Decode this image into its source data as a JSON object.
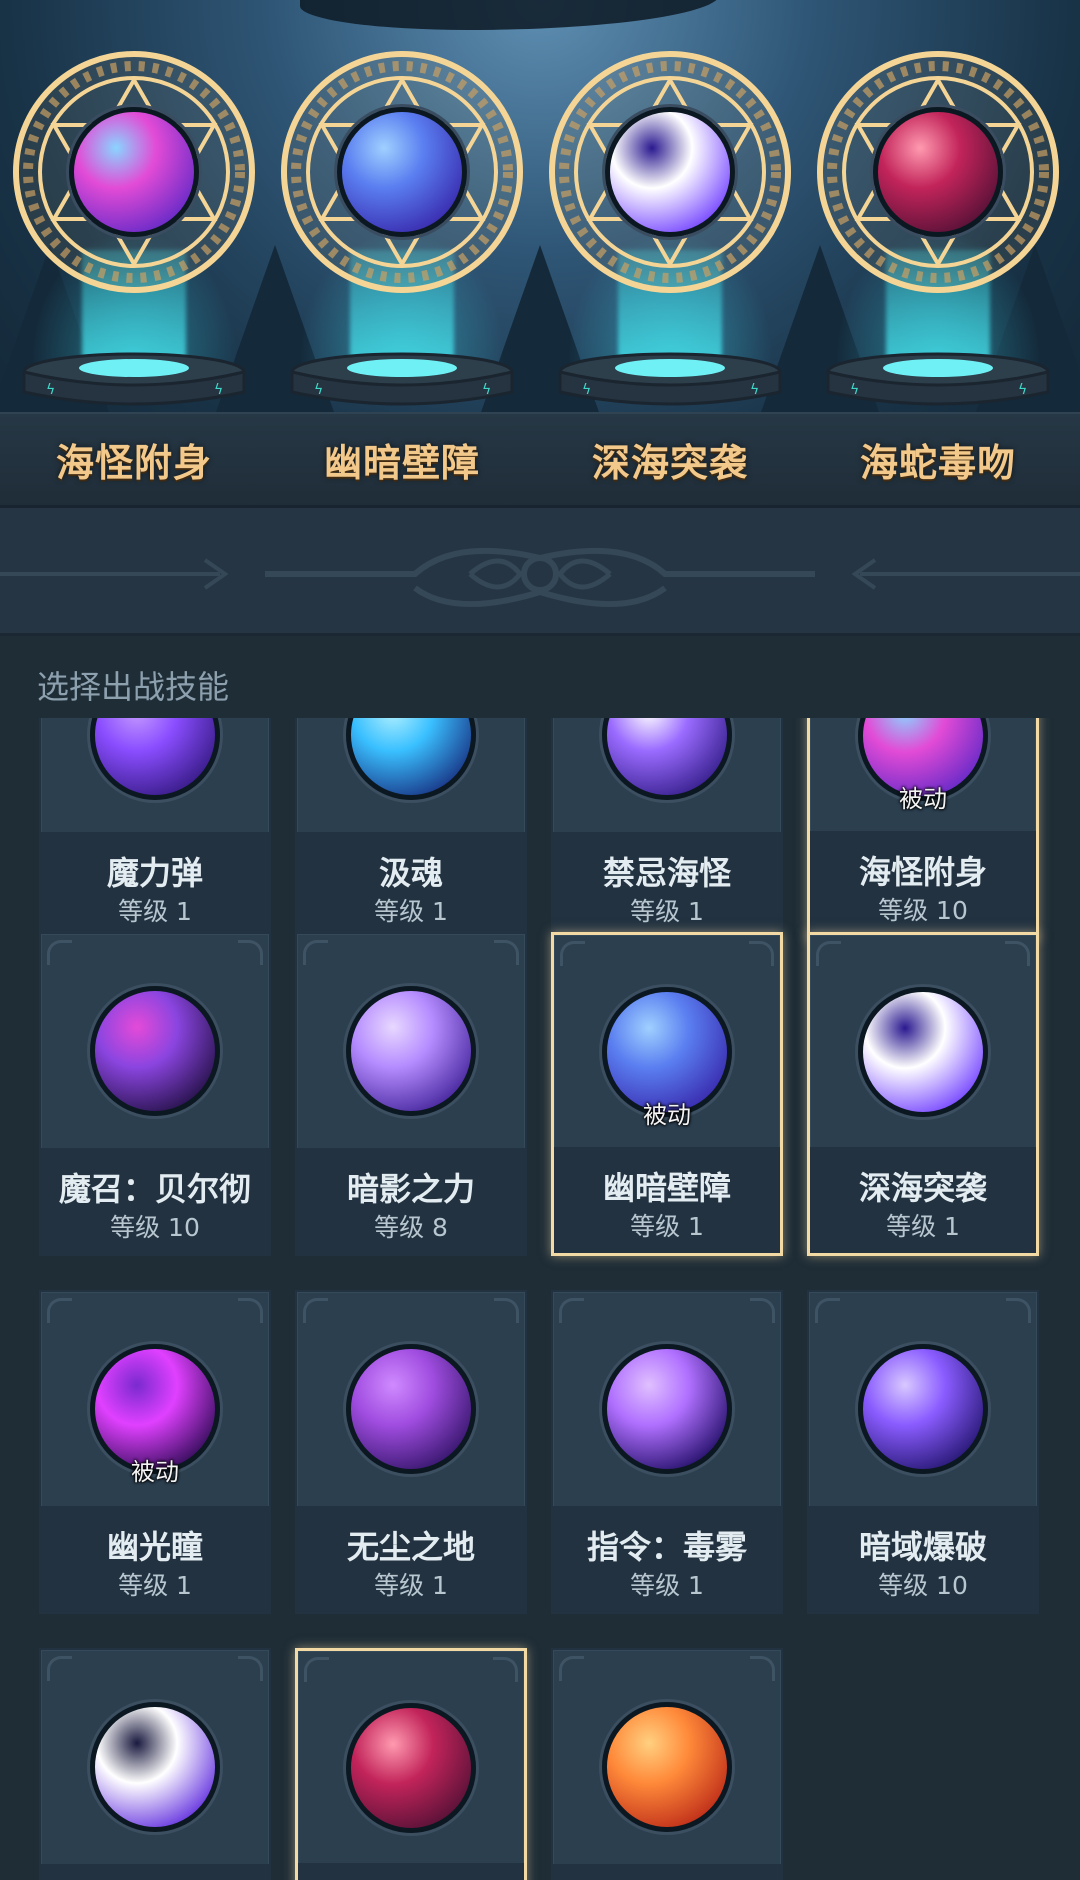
{
  "equipped": [
    {
      "name": "海怪附身",
      "icon": "kraken-possession-icon",
      "colors": [
        "#e24bd6",
        "#6a2bc8",
        "#8ad4ff"
      ]
    },
    {
      "name": "幽暗壁障",
      "icon": "dark-barrier-icon",
      "colors": [
        "#5a7ef0",
        "#3a2db0",
        "#9fd0ff"
      ]
    },
    {
      "name": "深海突袭",
      "icon": "deep-sea-strike-icon",
      "colors": [
        "#ffffff",
        "#7a4cff",
        "#2a1a90"
      ]
    },
    {
      "name": "海蛇毒吻",
      "icon": "sea-serpent-bite-icon",
      "colors": [
        "#c2245a",
        "#5a1238",
        "#ff9ab0"
      ]
    }
  ],
  "select_title": "选择出战技能",
  "skills": [
    {
      "name": "魔力弹",
      "level": "等级 1",
      "icon": "magic-bolt-icon",
      "colors": [
        "#8a4dff",
        "#3a1d8a",
        "#c49aff"
      ]
    },
    {
      "name": "汲魂",
      "level": "等级 1",
      "icon": "soul-drain-icon",
      "colors": [
        "#3ac0ff",
        "#1a3a8a",
        "#b0f0ff"
      ]
    },
    {
      "name": "禁忌海怪",
      "level": "等级 1",
      "icon": "forbidden-kraken-icon",
      "colors": [
        "#9a6bff",
        "#3a2290",
        "#ffffff"
      ]
    },
    {
      "name": "海怪附身",
      "level": "等级 10",
      "badge": "被动",
      "selected": true,
      "icon": "kraken-possession-icon",
      "colors": [
        "#e24bd6",
        "#6a2bc8",
        "#8ad4ff"
      ]
    },
    {
      "name": "魔召：贝尔彻",
      "level": "等级 10",
      "icon": "summon-belch-icon",
      "colors": [
        "#8b45e0",
        "#2a1450",
        "#e44ad8"
      ]
    },
    {
      "name": "暗影之力",
      "level": "等级 8",
      "icon": "shadow-power-icon",
      "colors": [
        "#b58cff",
        "#4a2aa0",
        "#e8d8ff"
      ]
    },
    {
      "name": "幽暗壁障",
      "level": "等级 1",
      "badge": "被动",
      "selected": true,
      "icon": "dark-barrier-icon",
      "colors": [
        "#5a7ef0",
        "#3a2db0",
        "#9fd0ff"
      ]
    },
    {
      "name": "深海突袭",
      "level": "等级 1",
      "selected": true,
      "icon": "deep-sea-strike-icon",
      "colors": [
        "#ffffff",
        "#7a4cff",
        "#2a1a90"
      ]
    },
    {
      "name": "幽光瞳",
      "level": "等级 1",
      "badge": "被动",
      "icon": "dark-eye-icon",
      "colors": [
        "#e040ff",
        "#3a0f60",
        "#7a2ad0"
      ]
    },
    {
      "name": "无尘之地",
      "level": "等级 1",
      "icon": "dustless-land-icon",
      "colors": [
        "#a04de0",
        "#3a1870",
        "#d08aff"
      ]
    },
    {
      "name": "指令：毒雾",
      "level": "等级 1",
      "icon": "poison-fog-icon",
      "colors": [
        "#b070ff",
        "#2a1470",
        "#e0c0ff"
      ]
    },
    {
      "name": "暗域爆破",
      "level": "等级 10",
      "icon": "dark-cube-icon",
      "colors": [
        "#8a5cff",
        "#2a1a78",
        "#d8c8ff"
      ]
    },
    {
      "name": "",
      "level": "",
      "icon": "moon-eclipse-icon",
      "colors": [
        "#ffffff",
        "#6a3ae0",
        "#1a1a40"
      ]
    },
    {
      "name": "",
      "level": "",
      "selected": true,
      "icon": "sea-serpent-bite-icon",
      "colors": [
        "#c2245a",
        "#5a1238",
        "#ff9ab0"
      ]
    },
    {
      "name": "",
      "level": "",
      "icon": "flame-sword-icon",
      "colors": [
        "#ff8a3a",
        "#c0301a",
        "#ffd080"
      ]
    }
  ]
}
